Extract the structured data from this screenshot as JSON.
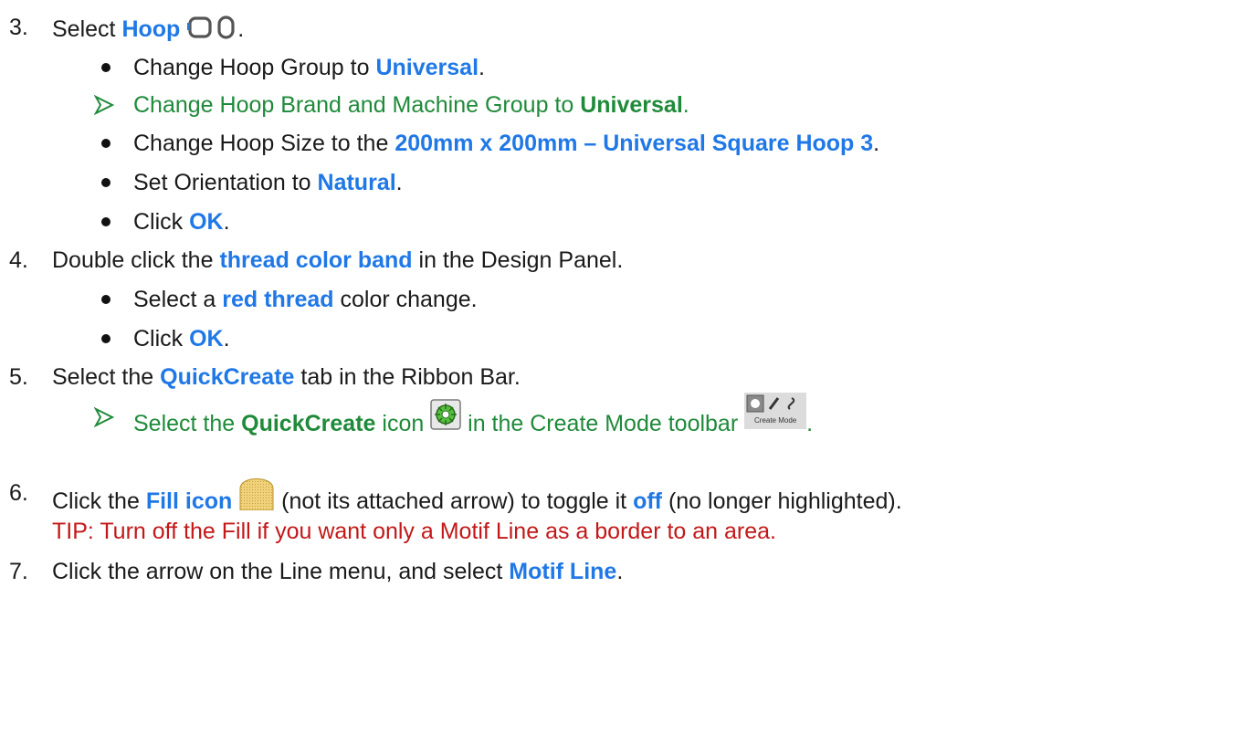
{
  "steps": [
    {
      "num": "3.",
      "lead": "Select ",
      "hl": "Hoop",
      "tail": ".",
      "icons": [
        "hoop-square-icon",
        "hoop-round-icon"
      ],
      "subs": [
        {
          "type": "dot",
          "pre": "Change Hoop Group to ",
          "hl": "Universal",
          "post": "."
        },
        {
          "type": "arrow",
          "pre": "Change Hoop Brand and Machine Group to ",
          "hl": "Universal",
          "post": "."
        },
        {
          "type": "dot",
          "pre": "Change Hoop Size to the ",
          "hl": "200mm x 200mm – Universal Square Hoop 3",
          "post": "."
        },
        {
          "type": "dot",
          "pre": "Set Orientation to ",
          "hl": "Natural",
          "post": "."
        },
        {
          "type": "dot",
          "pre": "Click ",
          "hl": "OK",
          "post": "."
        }
      ]
    },
    {
      "num": "4.",
      "lead": "Double click the ",
      "hl": "thread color band",
      "tail": " in the Design Panel.",
      "subs": [
        {
          "type": "dot",
          "pre": "Select a ",
          "hl": "red thread",
          "post": " color change."
        },
        {
          "type": "dot",
          "pre": "Click ",
          "hl": "OK",
          "post": "."
        }
      ]
    },
    {
      "num": "5.",
      "lead": "Select the ",
      "hl": "QuickCreate",
      "tail": " tab in the Ribbon Bar.",
      "subs": [
        {
          "type": "arrow",
          "pre": "Select the ",
          "hl": "QuickCreate",
          "mid": " icon ",
          "post2": " in the Create Mode toolbar ",
          "post": ".",
          "toolbar_caption": "Create Mode"
        }
      ]
    },
    {
      "num": "6.",
      "lead": "Click the ",
      "hl": "Fill icon",
      "mid": " (not its attached arrow) to toggle it ",
      "hl2": "off",
      "tail": " (no longer highlighted).",
      "tip": "TIP:  Turn off the Fill if you want only a Motif Line as a border to an area."
    },
    {
      "num": "7.",
      "lead": "Click the arrow on the Line menu, and select ",
      "hl": "Motif Line",
      "tail": "."
    }
  ],
  "colors": {
    "highlight": "#1f78e6",
    "green": "#1f8a3a",
    "tip": "#c21818"
  }
}
